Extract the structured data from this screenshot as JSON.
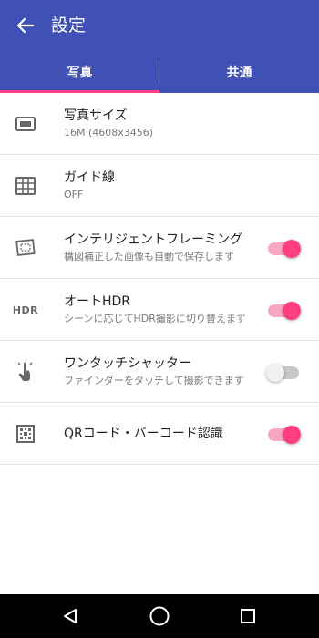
{
  "appbar": {
    "title": "設定",
    "back_icon": "arrow-back-icon"
  },
  "tabs": [
    {
      "label": "写真",
      "selected": true
    },
    {
      "label": "共通",
      "selected": false
    }
  ],
  "settings": [
    {
      "icon": "aspect-ratio-icon",
      "title": "写真サイズ",
      "subtitle": "16M (4608x3456)"
    },
    {
      "icon": "grid-lines-icon",
      "title": "ガイド線",
      "subtitle": "OFF"
    },
    {
      "icon": "framing-icon",
      "title": "インテリジェントフレーミング",
      "subtitle": "構図補正した画像も自動で保存します",
      "toggle": true
    },
    {
      "icon": "hdr-icon",
      "icon_text": "HDR",
      "title": "オートHDR",
      "subtitle": "シーンに応じてHDR撮影に切り替えます",
      "toggle": true
    },
    {
      "icon": "touch-icon",
      "title": "ワンタッチシャッター",
      "subtitle": "ファインダーをタッチして撮影できます",
      "toggle": false
    },
    {
      "icon": "qr-code-icon",
      "title": "QRコード・バーコード認識",
      "toggle": true
    }
  ],
  "navbar": {
    "back": "nav-back-icon",
    "home": "nav-home-icon",
    "recents": "nav-recents-icon"
  },
  "colors": {
    "primary": "#3f51b5",
    "accent": "#ff3e7f"
  }
}
